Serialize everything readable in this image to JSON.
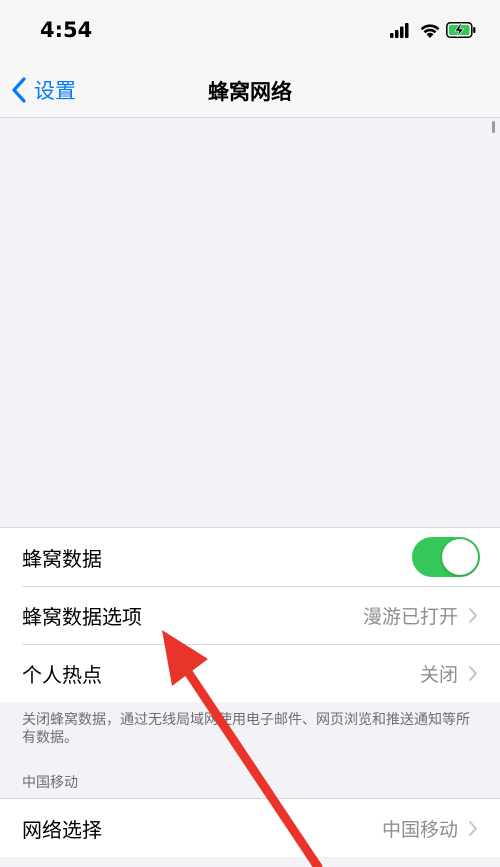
{
  "status_bar": {
    "time": "4:54"
  },
  "nav": {
    "back_label": "设置",
    "title": "蜂窝网络"
  },
  "group1": {
    "cellular_data": {
      "label": "蜂窝数据",
      "toggle_on": true
    },
    "cellular_options": {
      "label": "蜂窝数据选项",
      "value": "漫游已打开"
    },
    "hotspot": {
      "label": "个人热点",
      "value": "关闭"
    }
  },
  "footnote": "关闭蜂窝数据，通过无线局域网使用电子邮件、网页浏览和推送通知等所有数据。",
  "carrier_section": {
    "header": "中国移动",
    "network_selection": {
      "label": "网络选择",
      "value": "中国移动"
    }
  },
  "colors": {
    "accent": "#007aff",
    "toggle_on": "#34c759",
    "annotation_arrow": "#e8352b"
  }
}
